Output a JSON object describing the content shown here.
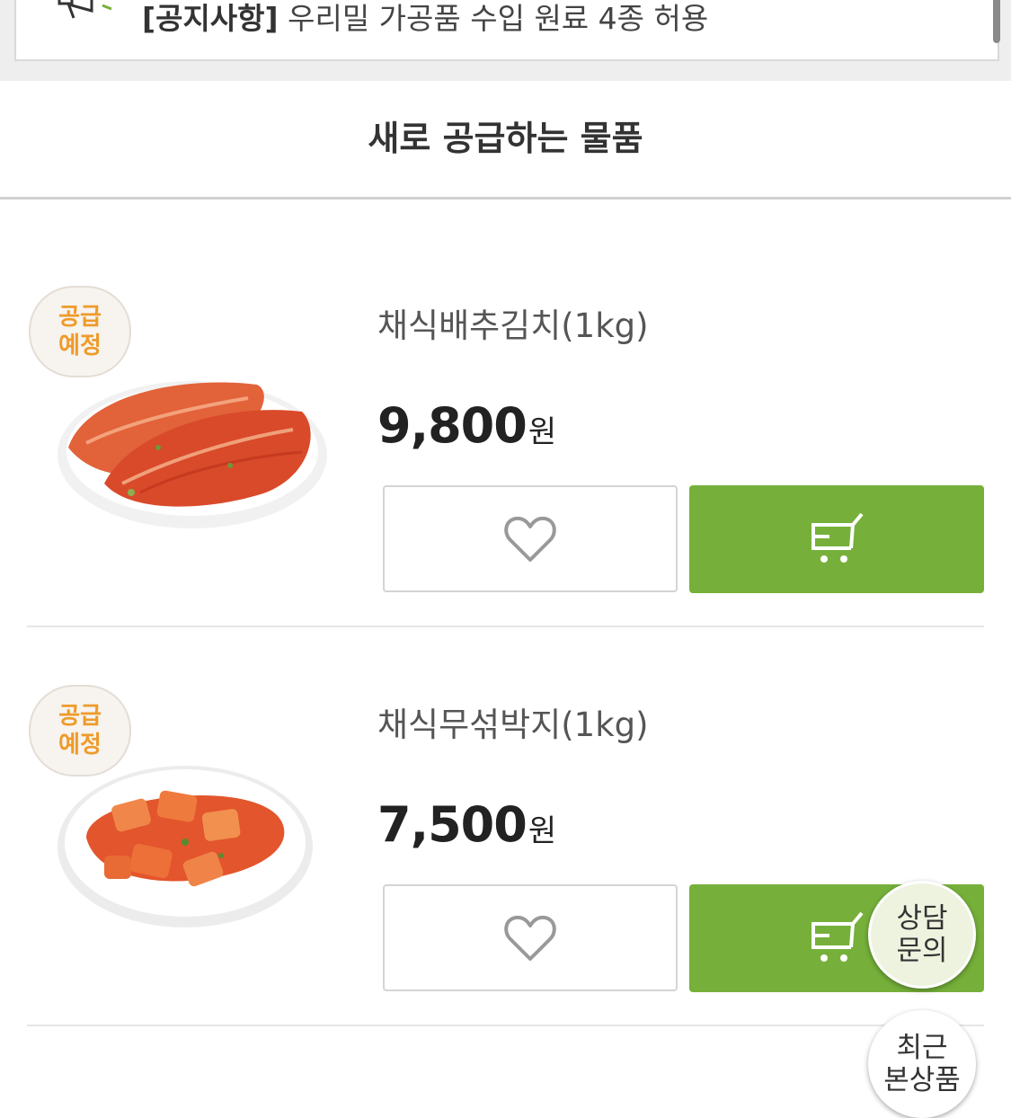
{
  "notice": {
    "icon": "megaphone-icon",
    "tag": "[공지사항]",
    "text": " 우리밀 가공품 수입 원료 4종 허용"
  },
  "section": {
    "title": "새로 공급하는 물품"
  },
  "products": [
    {
      "badge": "공급\n예정",
      "name": "채식배추김치(1kg)",
      "price": "9,800",
      "currency": "원",
      "image": "cabbage-kimchi-image"
    },
    {
      "badge": "공급\n예정",
      "name": "채식무섞박지(1kg)",
      "price": "7,500",
      "currency": "원",
      "image": "radish-kimchi-image"
    }
  ],
  "floating": {
    "consult": "상담\n문의",
    "recent": "최근\n본상품"
  },
  "colors": {
    "accent_green": "#76b03a",
    "badge_orange": "#ee9b2a"
  }
}
